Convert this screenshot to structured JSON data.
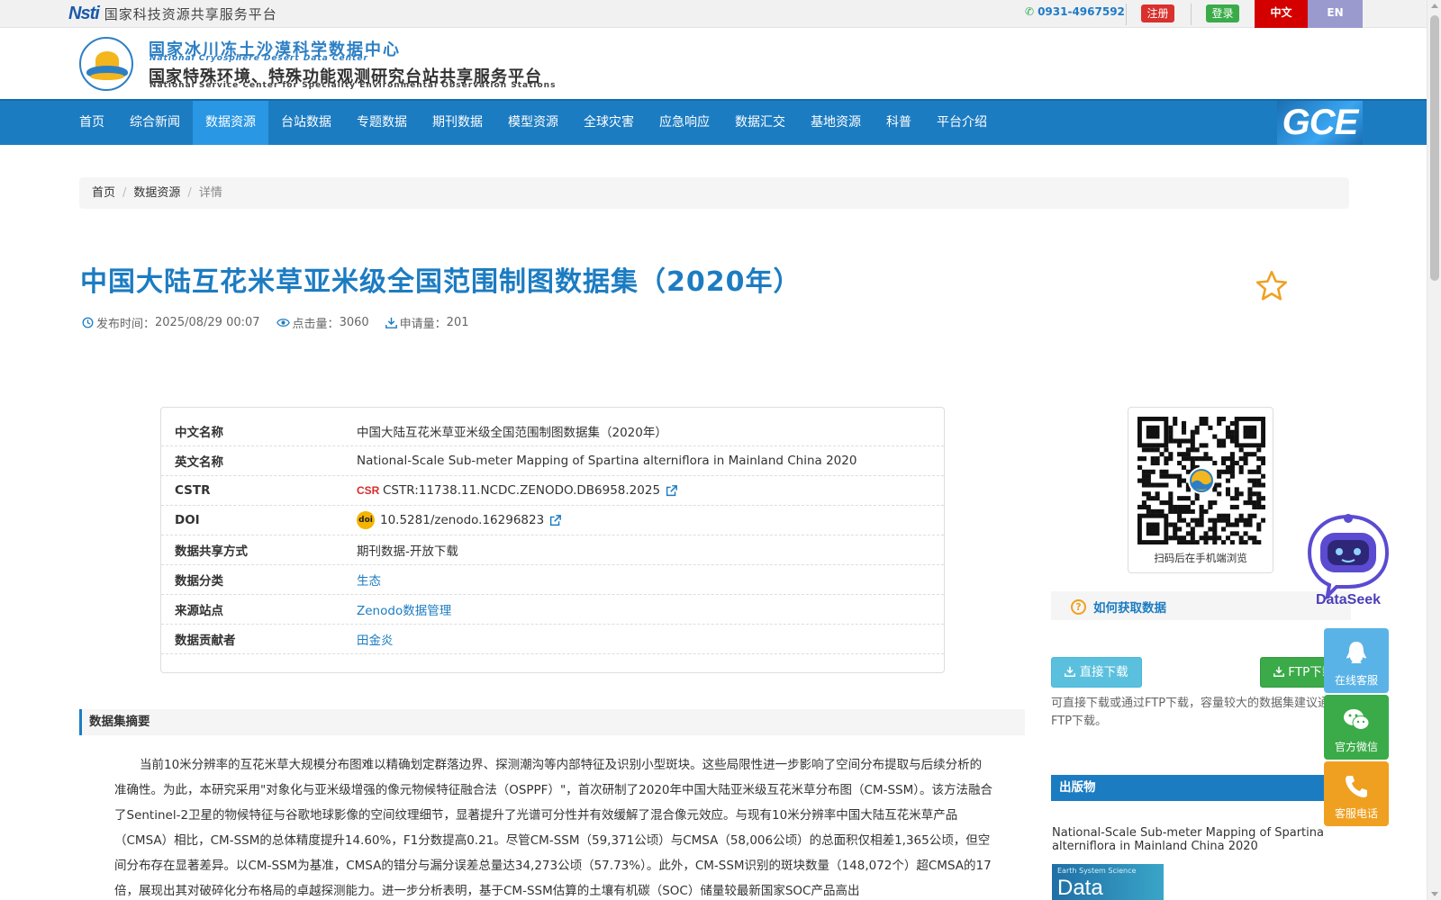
{
  "topbar": {
    "logo_text": "Nsti",
    "platform_name": "国家科技资源共享服务平台",
    "phone": "0931-4967592",
    "register_label": "注册",
    "login_label": "登录",
    "lang_zh": "中文",
    "lang_en": "EN"
  },
  "header": {
    "org_cn": "国家冰川冻土沙漠科学数据中心",
    "org_en": "National Cryosphere Desert Data Center",
    "org_cn2": "国家特殊环境、特殊功能观测研究台站共享服务平台",
    "org_en2": "National Service Center for Speciality Environmental Observation Stations"
  },
  "nav": {
    "items": [
      {
        "label": "首页"
      },
      {
        "label": "综合新闻"
      },
      {
        "label": "数据资源",
        "active": true
      },
      {
        "label": "台站数据"
      },
      {
        "label": "专题数据"
      },
      {
        "label": "期刊数据"
      },
      {
        "label": "模型资源"
      },
      {
        "label": "全球灾害"
      },
      {
        "label": "应急响应"
      },
      {
        "label": "数据汇交"
      },
      {
        "label": "基地资源"
      },
      {
        "label": "科普"
      },
      {
        "label": "平台介绍"
      }
    ],
    "gce_label": "GCE"
  },
  "breadcrumb": {
    "home": "首页",
    "section": "数据资源",
    "current": "详情"
  },
  "dataset": {
    "title": "中国大陆互花米草亚米级全国范围制图数据集（2020年）",
    "publish_label": "发布时间：",
    "publish_time": "2025/08/29 00:07",
    "views_label": "点击量：",
    "views": "3060",
    "requests_label": "申请量：",
    "requests": "201",
    "fields": [
      {
        "key": "中文名称",
        "value": "中国大陆互花米草亚米级全国范围制图数据集（2020年）"
      },
      {
        "key": "英文名称",
        "value": "National-Scale Sub-meter Mapping of Spartina alterniflora in Mainland China 2020"
      },
      {
        "key": "CSTR",
        "value": "CSTR:11738.11.NCDC.ZENODO.DB6958.2025"
      },
      {
        "key": "DOI",
        "value": "10.5281/zenodo.16296823"
      },
      {
        "key": "数据共享方式",
        "value": "期刊数据-开放下载"
      },
      {
        "key": "数据分类",
        "value": "生态"
      },
      {
        "key": "来源站点",
        "value": "Zenodo数据管理"
      },
      {
        "key": "数据贡献者",
        "value": "田金炎"
      }
    ],
    "cstr_badge": "CSR",
    "doi_badge": "doi",
    "abstract_title": "数据集摘要",
    "abstract": "当前10米分辨率的互花米草大规模分布图难以精确划定群落边界、探测潮沟等内部特征及识别小型斑块。这些局限性进一步影响了空间分布提取与后续分析的准确性。为此，本研究采用\"对象化与亚米级增强的像元物候特征融合法（OSPPF）\"，首次研制了2020年中国大陆亚米级互花米草分布图（CM-SSM）。该方法融合了Sentinel-2卫星的物候特征与谷歌地球影像的空间纹理细节，显著提升了光谱可分性并有效缓解了混合像元效应。与现有10米分辨率中国大陆互花米草产品（CMSA）相比，CM-SSM的总体精度提升14.60%，F1分数提高0.21。尽管CM-SSM（59,371公顷）与CMSA（58,006公顷）的总面积仅相差1,365公顷，但空间分布存在显著差异。以CM-SSM为基准，CMSA的错分与漏分误差总量达34,273公顷（57.73%）。此外，CM-SSM识别的斑块数量（148,072个）超CMSA的17倍，展现出其对破碎化分布格局的卓越探测能力。进一步分析表明，基于CM-SSM估算的土壤有机碳（SOC）储量较最新国家SOC产品高出"
  },
  "sidebar": {
    "qr_caption": "扫码后在手机端浏览",
    "how_title": "如何获取数据",
    "direct_label": "直接下载",
    "ftp_label": "FTP下载",
    "how_note": "可直接下载或通过FTP下载，容量较大的数据集建议通过FTP下载。",
    "pub_head": "出版物",
    "pub_title": "National-Scale Sub-meter Mapping of Spartina alterniflora in Mainland China 2020",
    "pub_cover_small": "Earth System Science",
    "pub_cover_big": "Data"
  },
  "widgets": {
    "dataseek_label": "DataSeek",
    "qq_label": "在线客服",
    "wechat_label": "官方微信",
    "phone_label": "客服电话"
  },
  "colors": {
    "primary": "#1c7cc2",
    "nav_active": "#2997e3",
    "register": "#d9312e",
    "login": "#3aab48",
    "lang_zh": "#d40000",
    "lang_en": "#9a9acf"
  }
}
